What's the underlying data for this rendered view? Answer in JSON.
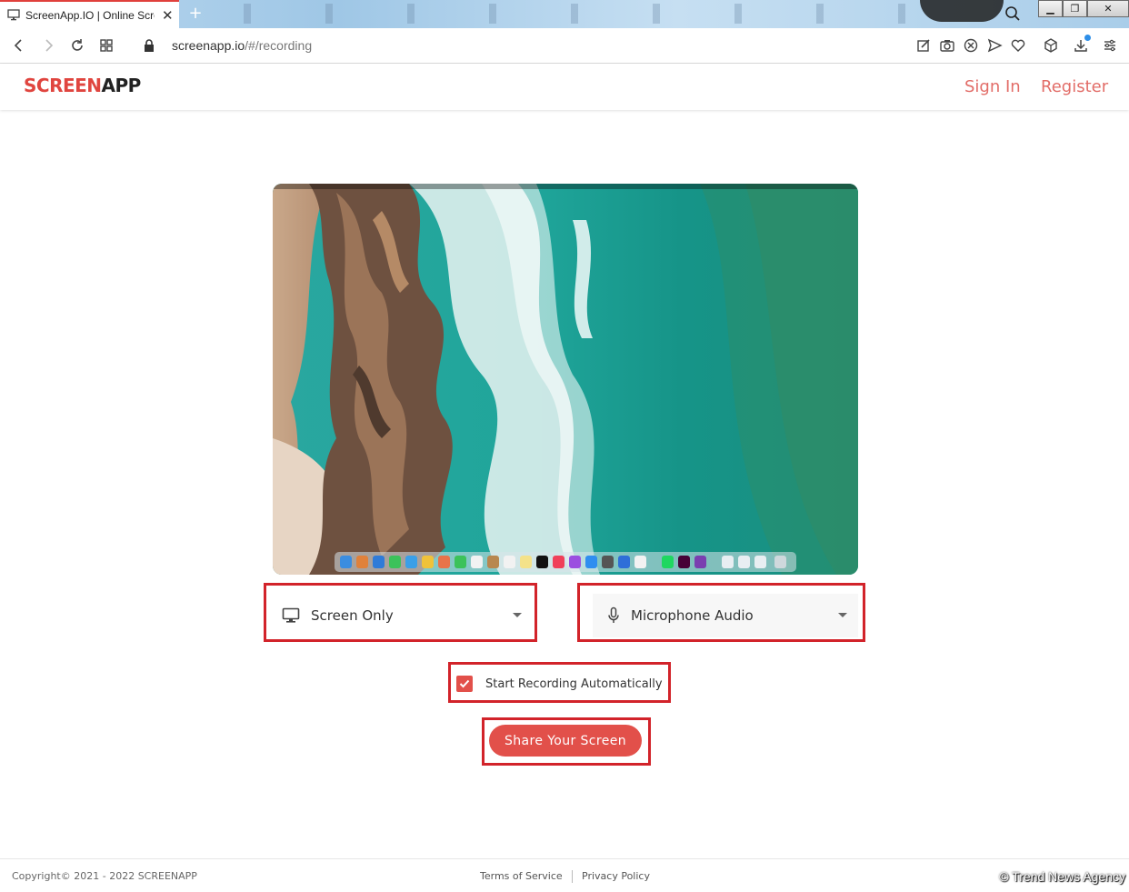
{
  "browser": {
    "tab_title": "ScreenApp.IO | Online Scre",
    "url_host": "screenapp.io",
    "url_path": "/#/recording"
  },
  "header": {
    "logo_part1": "SCREEN",
    "logo_part2": "APP",
    "sign_in": "Sign In",
    "register": "Register"
  },
  "controls": {
    "video_source": "Screen Only",
    "audio_source": "Microphone Audio",
    "auto_start_label": "Start Recording Automatically",
    "auto_start_checked": true,
    "share_button": "Share Your Screen"
  },
  "footer": {
    "copyright": "Copyright©   2021 - 2022 SCREENAPP",
    "terms": "Terms of Service",
    "privacy": "Privacy Policy"
  },
  "watermark": "© Trend News Agency",
  "colors": {
    "brand_red": "#e0453f",
    "button_red": "#e2504a",
    "highlight_red": "#d2232a"
  }
}
